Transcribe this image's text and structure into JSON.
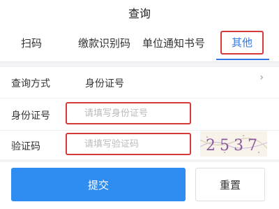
{
  "header": {
    "title": "查询"
  },
  "tabs": [
    {
      "label": "扫码"
    },
    {
      "label": "缴款识别码"
    },
    {
      "label": "单位通知书号"
    },
    {
      "label": "其他",
      "active": true
    }
  ],
  "form": {
    "query_method": {
      "label": "查询方式",
      "value": "身份证号",
      "chevron": "›"
    },
    "id_number": {
      "label": "身份证号",
      "placeholder": "请填写身份证号",
      "value": ""
    },
    "captcha": {
      "label": "验证码",
      "placeholder": "请填写验证码",
      "value": "",
      "image_text": "2537"
    }
  },
  "actions": {
    "submit_label": "提交",
    "reset_label": "重置"
  },
  "colors": {
    "accent": "#2f8cf0",
    "highlight": "#d33a3a"
  }
}
